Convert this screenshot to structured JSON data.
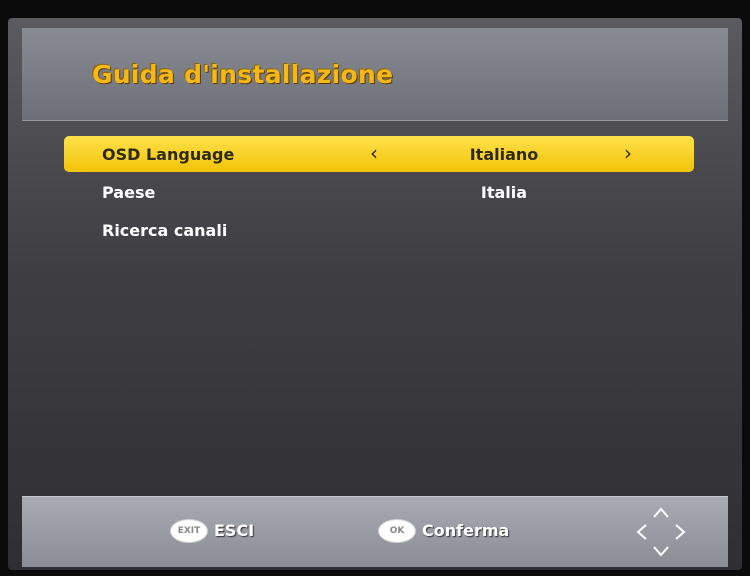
{
  "header": {
    "title": "Guida d'installazione"
  },
  "menu": {
    "items": [
      {
        "label": "OSD Language",
        "value": "Italiano",
        "selected": true
      },
      {
        "label": "Paese",
        "value": "Italia",
        "selected": false
      },
      {
        "label": "Ricerca canali",
        "value": "",
        "selected": false
      }
    ],
    "left_arrow": "‹",
    "right_arrow": "›"
  },
  "footer": {
    "exit_key": "EXIT",
    "exit_label": "ESCI",
    "ok_key": "OK",
    "ok_label": "Conferma",
    "nav_icon": "directional-pad-icon"
  },
  "colors": {
    "title": "#f5b81a",
    "highlight": "#f2c409",
    "background": "#3e3e43",
    "footer": "#9a9ca4"
  }
}
